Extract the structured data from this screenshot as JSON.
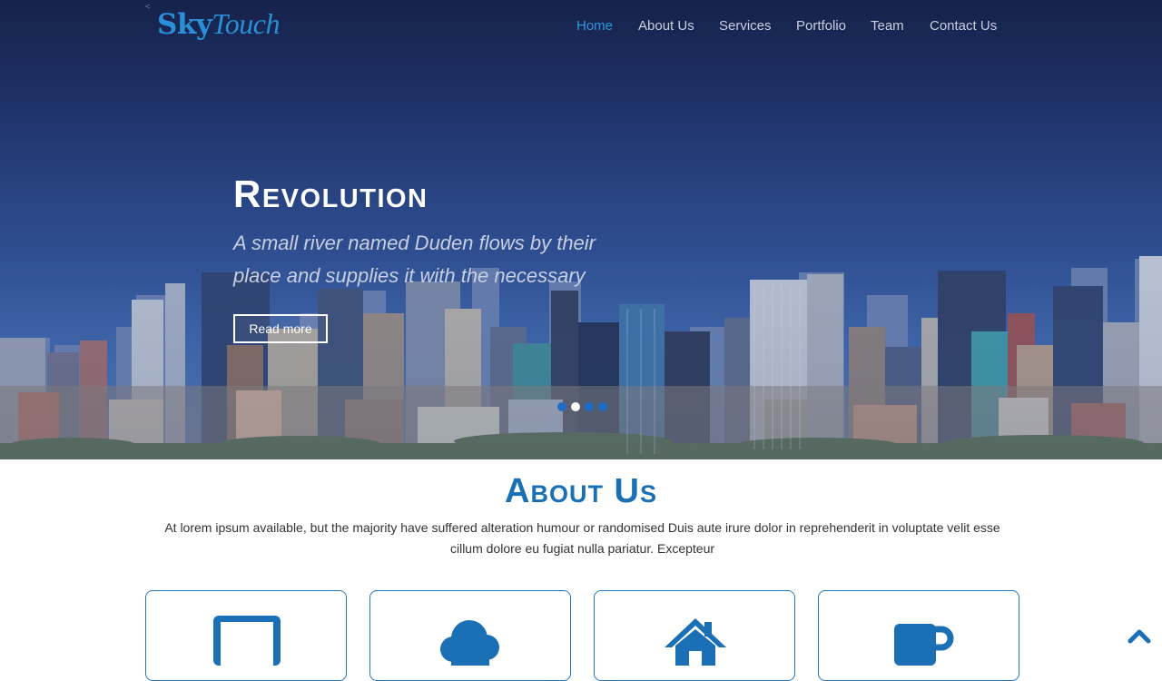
{
  "brand": {
    "part1": "Sky",
    "part2": "Touch",
    "color": "#2a8fd6"
  },
  "nav": {
    "items": [
      {
        "label": "Home",
        "active": true
      },
      {
        "label": "About Us",
        "active": false
      },
      {
        "label": "Services",
        "active": false
      },
      {
        "label": "Portfolio",
        "active": false
      },
      {
        "label": "Team",
        "active": false
      },
      {
        "label": "Contact Us",
        "active": false
      }
    ],
    "active_color": "#2d97e3"
  },
  "hero": {
    "title": "Revolution",
    "subtitle_line1": "A small river named Duden flows by their",
    "subtitle_line2": "place and supplies it with the necessary",
    "button_label": "Read more",
    "slides": 4,
    "active_slide": 2
  },
  "about": {
    "title": "About Us",
    "text": "At lorem ipsum available, but the majority have suffered alteration humour or randomised Duis aute irure dolor in reprehenderit in voluptate velit esse cillum dolore eu fugiat nulla pariatur. Excepteur",
    "cards": [
      {
        "icon": "laptop-icon"
      },
      {
        "icon": "cloud-icon"
      },
      {
        "icon": "home-icon"
      },
      {
        "icon": "coffee-mug-icon"
      }
    ],
    "accent_color": "#1a6fb5"
  },
  "scroll_top": {
    "icon": "chevron-up-icon"
  }
}
